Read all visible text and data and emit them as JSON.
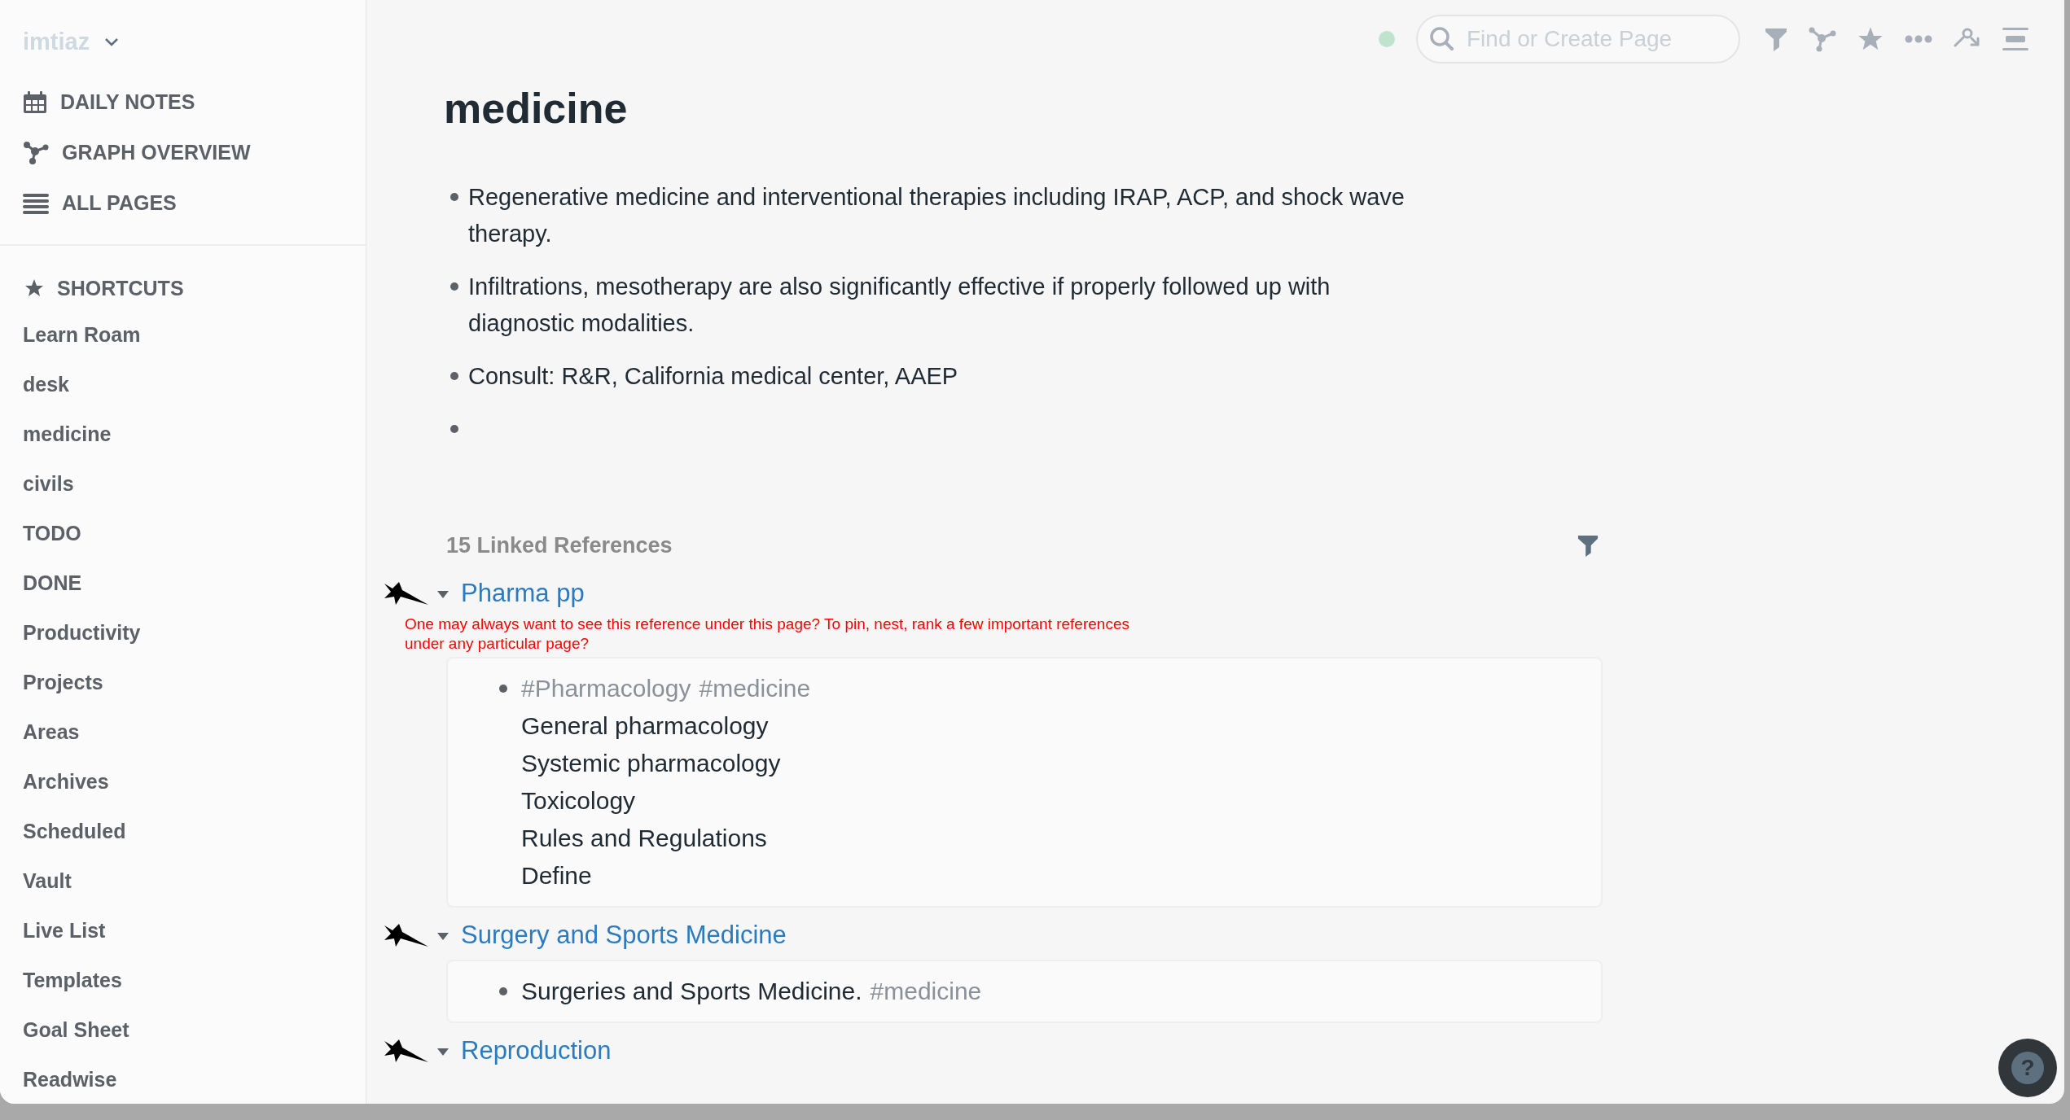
{
  "sidebar": {
    "graph_name": "imtiaz",
    "nav": [
      {
        "label": "DAILY NOTES",
        "kind": "calendar"
      },
      {
        "label": "GRAPH OVERVIEW",
        "kind": "graph"
      },
      {
        "label": "ALL PAGES",
        "kind": "list"
      }
    ],
    "shortcuts_title": "SHORTCUTS",
    "shortcuts": [
      "Learn Roam",
      "desk",
      "medicine",
      "civils",
      "TODO",
      "DONE",
      "Productivity",
      "Projects",
      "Areas",
      "Archives",
      "Scheduled",
      "Vault",
      "Live List",
      "Templates",
      "Goal Sheet",
      "Readwise"
    ]
  },
  "topbar": {
    "search": {
      "placeholder": "Find or Create Page"
    }
  },
  "page": {
    "title": "medicine",
    "blocks": [
      {
        "kind": "text",
        "text": "Regenerative medicine and interventional therapies including IRAP, ACP, and shock wave therapy."
      },
      {
        "kind": "text",
        "text": "Infiltrations, mesotherapy are also significantly effective if properly followed up with diagnostic modalities."
      },
      {
        "kind": "text",
        "text": "Consult: R&R, California medical center, AAEP"
      },
      {
        "kind": "empty"
      }
    ]
  },
  "linked_references": {
    "heading": "15 Linked References",
    "groups": [
      {
        "title": "Pharma pp",
        "expanded": true,
        "note": "One may always want to see this reference under this page? To pin, nest, rank a few important references under any particular page?",
        "lines": [
          [
            {
              "kind": "tag",
              "text": "#Pharmacology"
            },
            {
              "kind": "tag",
              "text": "#medicine"
            }
          ],
          [
            {
              "kind": "plain",
              "text": "General pharmacology"
            }
          ],
          [
            {
              "kind": "plain",
              "text": "Systemic pharmacology"
            }
          ],
          [
            {
              "kind": "plain",
              "text": "Toxicology"
            }
          ],
          [
            {
              "kind": "plain",
              "text": "Rules and Regulations"
            }
          ],
          [
            {
              "kind": "plain",
              "text": "Define"
            }
          ]
        ]
      },
      {
        "title": "Surgery and Sports Medicine",
        "expanded": true,
        "lines": [
          [
            {
              "kind": "plain",
              "text": "Surgeries and Sports Medicine."
            },
            {
              "kind": "tag",
              "text": "#medicine"
            }
          ]
        ]
      },
      {
        "title": "Reproduction",
        "expanded": true
      }
    ]
  },
  "help_button": "?"
}
